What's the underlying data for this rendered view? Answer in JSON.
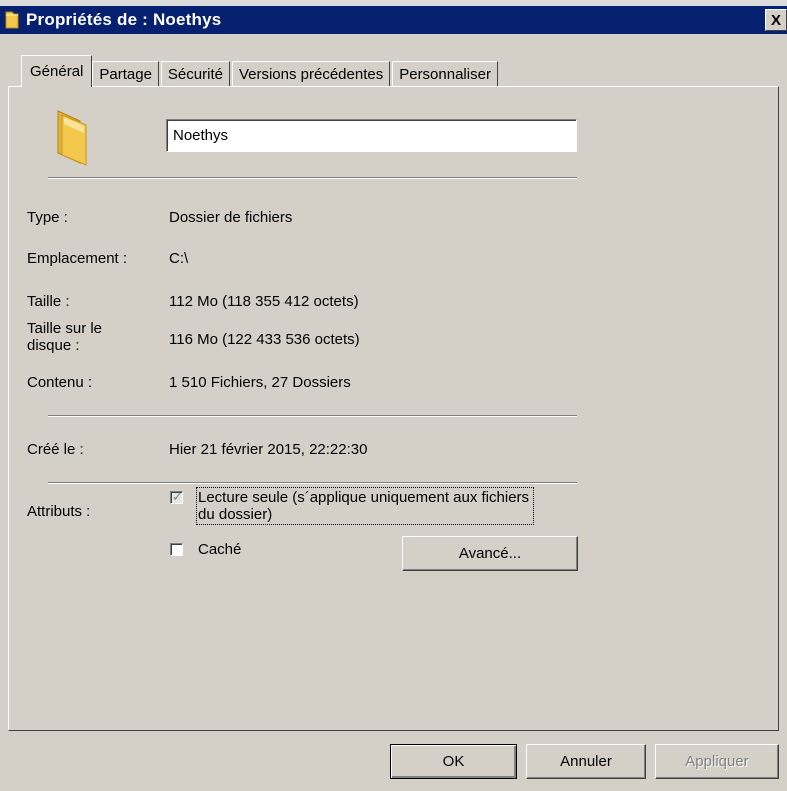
{
  "window": {
    "title": "Propriétés de : Noethys",
    "close_label": "X"
  },
  "tabs": [
    {
      "label": "Général",
      "active": true
    },
    {
      "label": "Partage",
      "active": false
    },
    {
      "label": "Sécurité",
      "active": false
    },
    {
      "label": "Versions précédentes",
      "active": false
    },
    {
      "label": "Personnaliser",
      "active": false
    }
  ],
  "icons": {
    "title_icon": "folder-icon",
    "big_icon": "folder-icon"
  },
  "name_field": {
    "value": "Noethys"
  },
  "properties": [
    {
      "label": "Type :",
      "value": "Dossier de fichiers"
    },
    {
      "label": "Emplacement :",
      "value": "C:\\"
    },
    {
      "label": "Taille :",
      "value": "112 Mo (118 355 412 octets)"
    },
    {
      "label": "Taille sur le disque :",
      "value": "116 Mo (122 433 536 octets)"
    },
    {
      "label": "Contenu :",
      "value": "1 510 Fichiers, 27 Dossiers"
    }
  ],
  "created": {
    "label": "Créé le :",
    "value": "Hier 21 février 2015, 22:22:30"
  },
  "attributes": {
    "label": "Attributs :",
    "readonly": {
      "label": "Lecture seule (s´applique uniquement aux fichiers du dossier)",
      "checked": true
    },
    "hidden": {
      "label": "Caché",
      "checked": false
    },
    "advanced_button": "Avancé..."
  },
  "buttons": {
    "ok": "OK",
    "cancel": "Annuler",
    "apply": "Appliquer"
  },
  "colors": {
    "titlebar": "#05206f",
    "face": "#d4d0c8",
    "folder": "#f2c94c"
  }
}
